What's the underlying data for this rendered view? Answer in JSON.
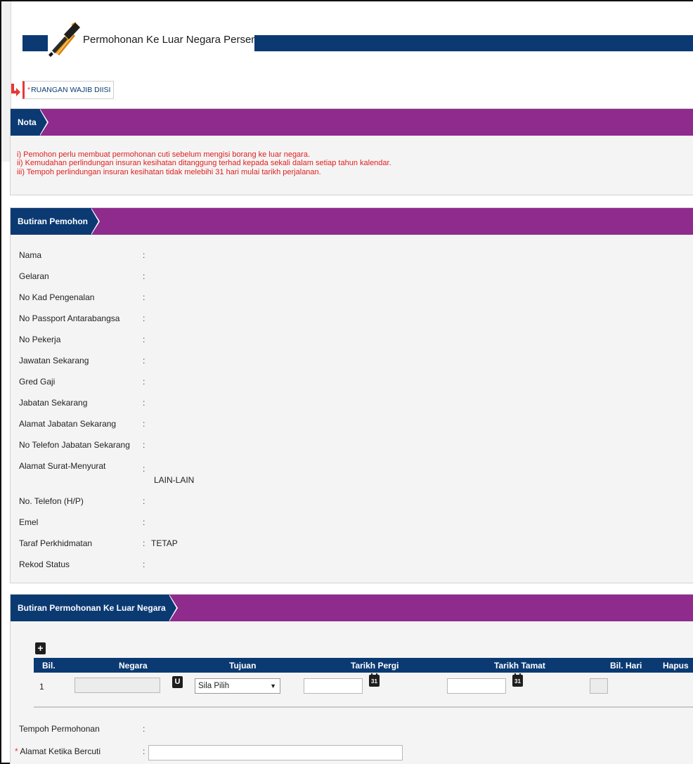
{
  "page": {
    "title": "Permohonan Ke Luar Negara Persendirian",
    "mandatory_note_star": "*",
    "mandatory_note": "RUANGAN WAJIB DIISI"
  },
  "nota": {
    "tab": "Nota",
    "lines": [
      "i) Pemohon perlu membuat permohonan cuti sebelum mengisi borang ke luar negara.",
      "ii) Kemudahan perlindungan insuran kesihatan ditanggung terhad kepada sekali dalam setiap tahun kalendar.",
      "iii) Tempoh perlindungan insuran kesihatan tidak melebihi 31 hari mulai tarikh perjalanan."
    ]
  },
  "pemohon": {
    "tab": "Butiran Pemohon",
    "fields": [
      {
        "label": "Nama",
        "colon": ":",
        "value": ""
      },
      {
        "label": "Gelaran",
        "colon": ":",
        "value": ""
      },
      {
        "label": "No Kad Pengenalan",
        "colon": ":",
        "value": ""
      },
      {
        "label": "No Passport Antarabangsa",
        "colon": ":",
        "value": ""
      },
      {
        "label": "No Pekerja",
        "colon": ":",
        "value": ""
      },
      {
        "label": "Jawatan Sekarang",
        "colon": ":",
        "value": ""
      },
      {
        "label": "Gred Gaji",
        "colon": ":",
        "value": ""
      },
      {
        "label": "Jabatan Sekarang",
        "colon": ":",
        "value": ""
      },
      {
        "label": "Alamat Jabatan Sekarang",
        "colon": ":",
        "value": ""
      },
      {
        "label": "No Telefon Jabatan Sekarang",
        "colon": ":",
        "value": ""
      },
      {
        "label": "Alamat Surat-Menyurat",
        "colon": ":",
        "value": "LAIN-LAIN"
      },
      {
        "label": "No. Telefon (H/P)",
        "colon": ":",
        "value": ""
      },
      {
        "label": "Emel",
        "colon": ":",
        "value": ""
      },
      {
        "label": "Taraf Perkhidmatan",
        "colon": ":",
        "value": "TETAP"
      },
      {
        "label": "Rekod Status",
        "colon": ":",
        "value": ""
      }
    ]
  },
  "permohonan": {
    "tab": "Butiran Permohonan Ke Luar Negara",
    "add_icon": "plus-icon",
    "columns": [
      "Bil.",
      "Negara",
      "Tujuan",
      "Tarikh Pergi",
      "Tarikh Tamat",
      "Bil. Hari",
      "Hapus"
    ],
    "rows": [
      {
        "bil": "1",
        "negara": "",
        "tujuan": "Sila Pilih",
        "tarikh_pergi": "",
        "tarikh_tamat": "",
        "bil_hari": ""
      }
    ],
    "calendar_glyph": "31",
    "reset_glyph": "U",
    "select_arrow": "▼",
    "tempoh_label": "Tempoh Permohonan",
    "tempoh_colon": ":",
    "alamat_label": "Alamat Ketika Bercuti",
    "alamat_colon": ":",
    "alamat_star": "*",
    "alamat_value": ""
  },
  "colors": {
    "navy": "#0b3a73",
    "purple": "#8e2b8c",
    "note_red": "#e01e1e"
  }
}
